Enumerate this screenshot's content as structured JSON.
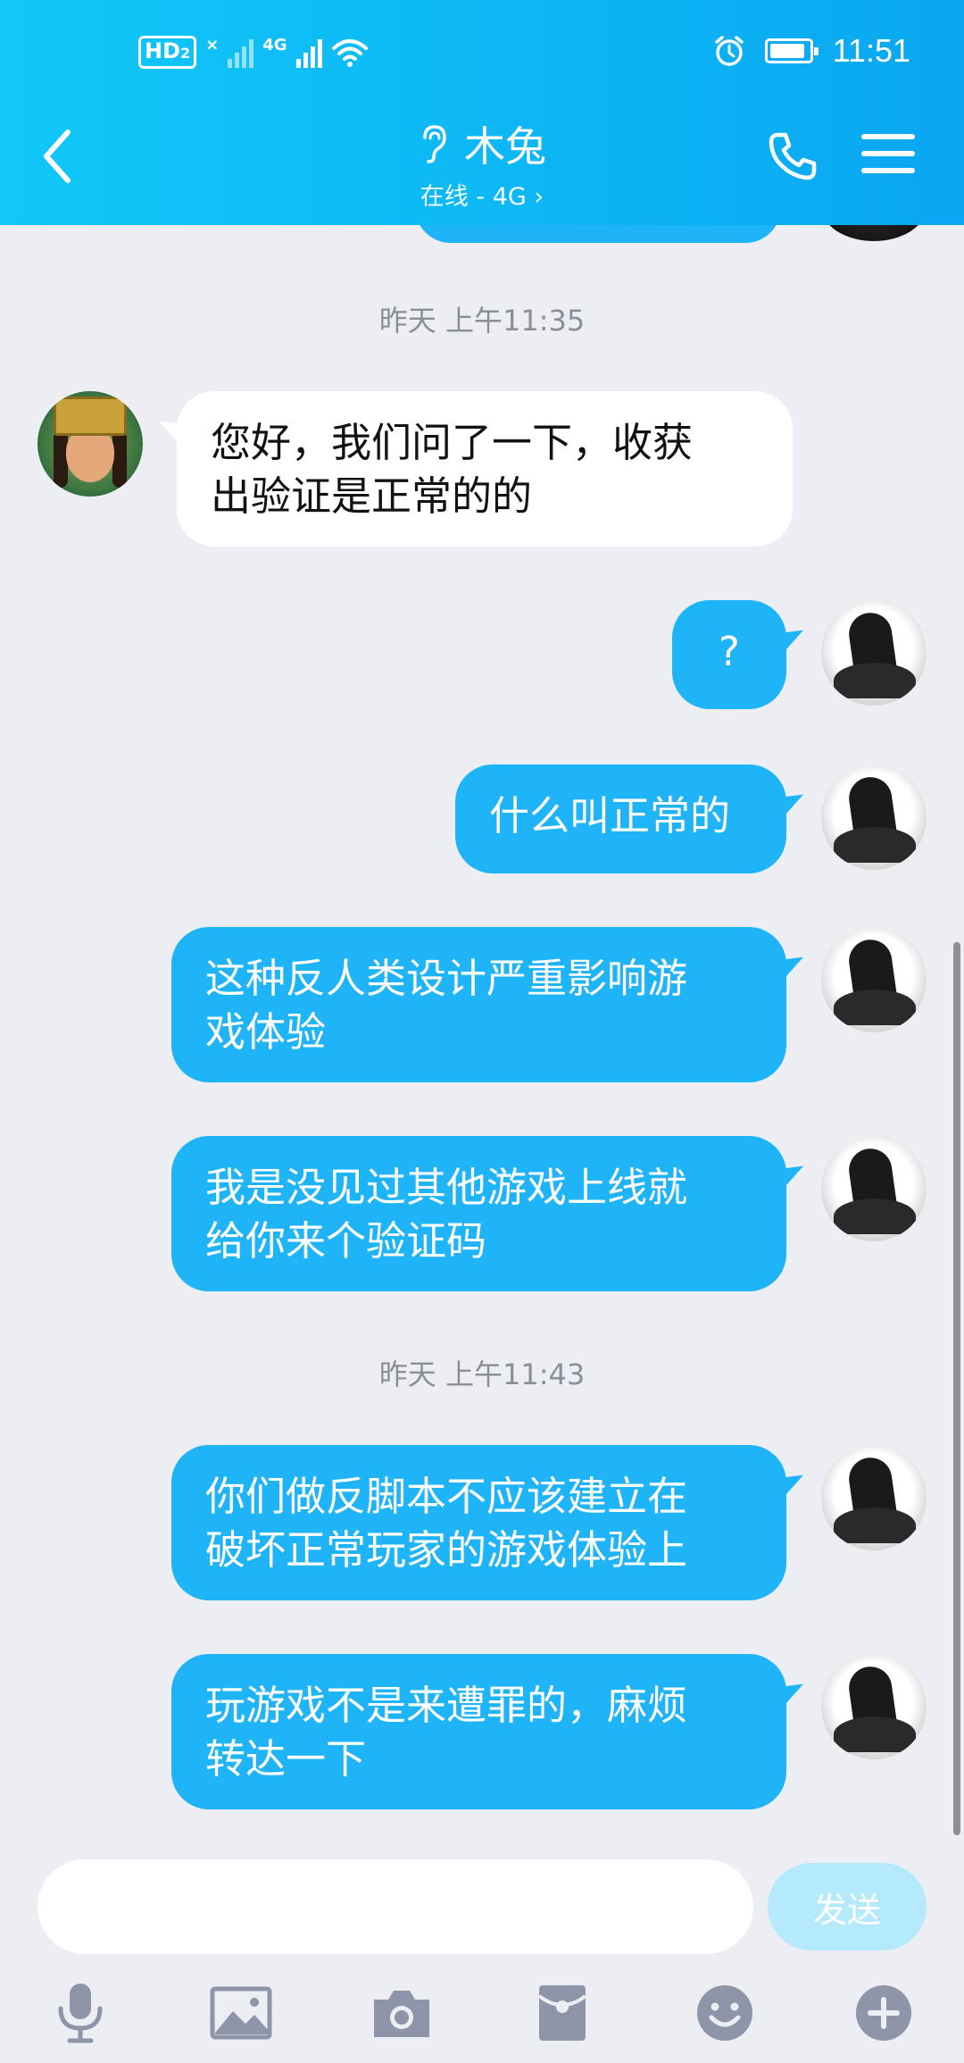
{
  "status_bar": {
    "hd_label": "HD",
    "hd_sub": "2",
    "sim1_label": "×",
    "sim2_label": "4G",
    "time": "11:51"
  },
  "header": {
    "title": "木兔",
    "subtitle": "在线 - 4G ›",
    "icons": [
      "back-arrow-icon",
      "ear-icon",
      "phone-icon",
      "menu-icon"
    ]
  },
  "chat": {
    "timestamps": [
      "昨天 上午11:35",
      "昨天 上午11:43"
    ],
    "messages": [
      {
        "sender": "other",
        "text": "您好，我们问了一下，收获\n出验证是正常的的"
      },
      {
        "sender": "me",
        "text": "?"
      },
      {
        "sender": "me",
        "text": "什么叫正常的"
      },
      {
        "sender": "me",
        "text": "这种反人类设计严重影响游\n戏体验"
      },
      {
        "sender": "me",
        "text": "我是没见过其他游戏上线就\n给你来个验证码"
      },
      {
        "sender": "me",
        "text": "你们做反脚本不应该建立在\n破坏正常玩家的游戏体验上"
      },
      {
        "sender": "me",
        "text": "玩游戏不是来遭罪的，麻烦\n转达一下"
      }
    ]
  },
  "input": {
    "value": "",
    "send_label": "发送"
  },
  "toolbar": {
    "icons": [
      "microphone-icon",
      "image-icon",
      "camera-icon",
      "red-packet-icon",
      "emoji-icon",
      "plus-icon"
    ]
  },
  "colors": {
    "header_start": "#11c8f8",
    "header_end": "#0aa7f2",
    "outgoing_bubble": "#1fb4f7",
    "incoming_bubble": "#ffffff",
    "background": "#eceef4",
    "toolbar_icon": "#8f95a8"
  },
  "battery_level": 0.9
}
